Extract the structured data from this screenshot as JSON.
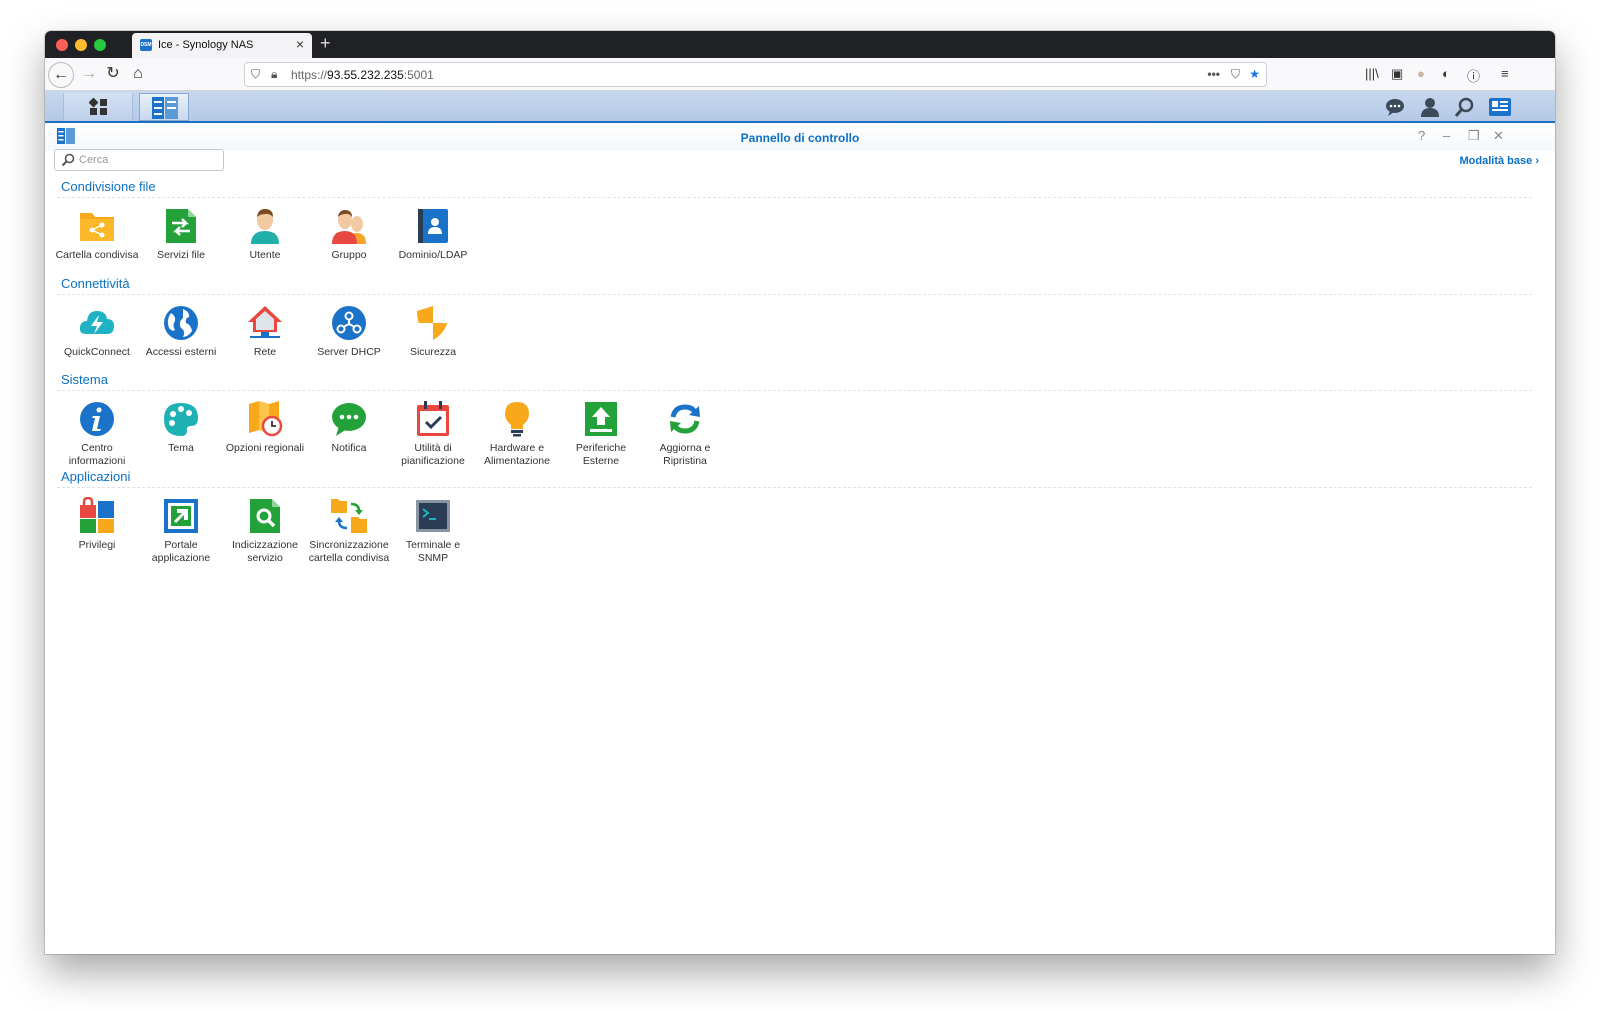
{
  "browser": {
    "tab_title": "Ice - Synology NAS",
    "tab_favicon_text": "DSM",
    "url_scheme": "https://",
    "url_host": "93.55.232.235",
    "url_port": ":5001"
  },
  "dsm": {
    "window_title": "Pannello di controllo",
    "search_placeholder": "Cerca",
    "basic_mode_label": "Modalità base"
  },
  "sections": [
    {
      "title": "Condivisione file",
      "items": [
        {
          "label": "Cartella condivisa",
          "icon": "shared-folder-icon"
        },
        {
          "label": "Servizi file",
          "icon": "file-services-icon"
        },
        {
          "label": "Utente",
          "icon": "user-icon"
        },
        {
          "label": "Gruppo",
          "icon": "group-icon"
        },
        {
          "label": "Dominio/LDAP",
          "icon": "domain-ldap-icon"
        }
      ]
    },
    {
      "title": "Connettività",
      "items": [
        {
          "label": "QuickConnect",
          "icon": "quickconnect-icon"
        },
        {
          "label": "Accessi esterni",
          "icon": "external-access-icon"
        },
        {
          "label": "Rete",
          "icon": "network-icon"
        },
        {
          "label": "Server DHCP",
          "icon": "dhcp-server-icon"
        },
        {
          "label": "Sicurezza",
          "icon": "security-icon"
        }
      ]
    },
    {
      "title": "Sistema",
      "items": [
        {
          "label": "Centro informazioni",
          "icon": "info-center-icon"
        },
        {
          "label": "Tema",
          "icon": "theme-icon"
        },
        {
          "label": "Opzioni regionali",
          "icon": "regional-options-icon"
        },
        {
          "label": "Notifica",
          "icon": "notification-icon"
        },
        {
          "label": "Utilità di pianificazione",
          "icon": "task-scheduler-icon"
        },
        {
          "label": "Hardware e Alimentazione",
          "icon": "hardware-power-icon"
        },
        {
          "label": "Periferiche Esterne",
          "icon": "external-devices-icon"
        },
        {
          "label": "Aggiorna e Ripristina",
          "icon": "update-restore-icon"
        }
      ]
    },
    {
      "title": "Applicazioni",
      "items": [
        {
          "label": "Privilegi",
          "icon": "privileges-icon"
        },
        {
          "label": "Portale applicazione",
          "icon": "application-portal-icon"
        },
        {
          "label": "Indicizzazione servizio",
          "icon": "indexing-service-icon"
        },
        {
          "label": "Sincronizzazione cartella condivisa",
          "icon": "shared-folder-sync-icon"
        },
        {
          "label": "Terminale e SNMP",
          "icon": "terminal-snmp-icon"
        }
      ]
    }
  ],
  "colors": {
    "accent": "#0b71c6",
    "taskbar": "#c7d8ef"
  }
}
